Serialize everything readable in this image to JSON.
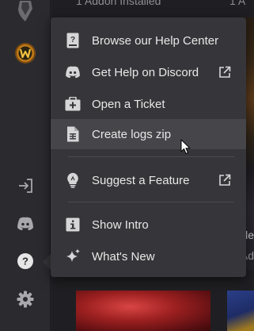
{
  "background": {
    "top_left_text": "1 Addon Installed",
    "top_right_text": "1 A",
    "side_text_1": "rle",
    "side_text_2": "Ad"
  },
  "sidebar": {
    "items": [
      {
        "icon": "world-of-tanks-icon"
      },
      {
        "icon": "world-of-warcraft-icon"
      },
      {
        "icon": "login-icon"
      },
      {
        "icon": "discord-icon"
      },
      {
        "icon": "help-icon"
      },
      {
        "icon": "gear-icon"
      }
    ]
  },
  "help_menu": {
    "items": [
      {
        "label": "Browse our Help Center",
        "icon": "help-center-icon"
      },
      {
        "label": "Get Help on Discord",
        "icon": "discord-icon",
        "external": true
      },
      {
        "label": "Open a Ticket",
        "icon": "ticket-icon"
      },
      {
        "label": "Create logs zip",
        "icon": "file-zip-icon",
        "hovered": true
      },
      {
        "label": "Suggest a Feature",
        "icon": "lightbulb-icon",
        "external": true
      },
      {
        "label": "Show Intro",
        "icon": "info-icon"
      },
      {
        "label": "What's New",
        "icon": "sparkle-icon"
      }
    ]
  },
  "colors": {
    "menu_bg": "#36363a",
    "menu_hover": "#45454a",
    "sidebar_bg": "#2b2b2f"
  }
}
